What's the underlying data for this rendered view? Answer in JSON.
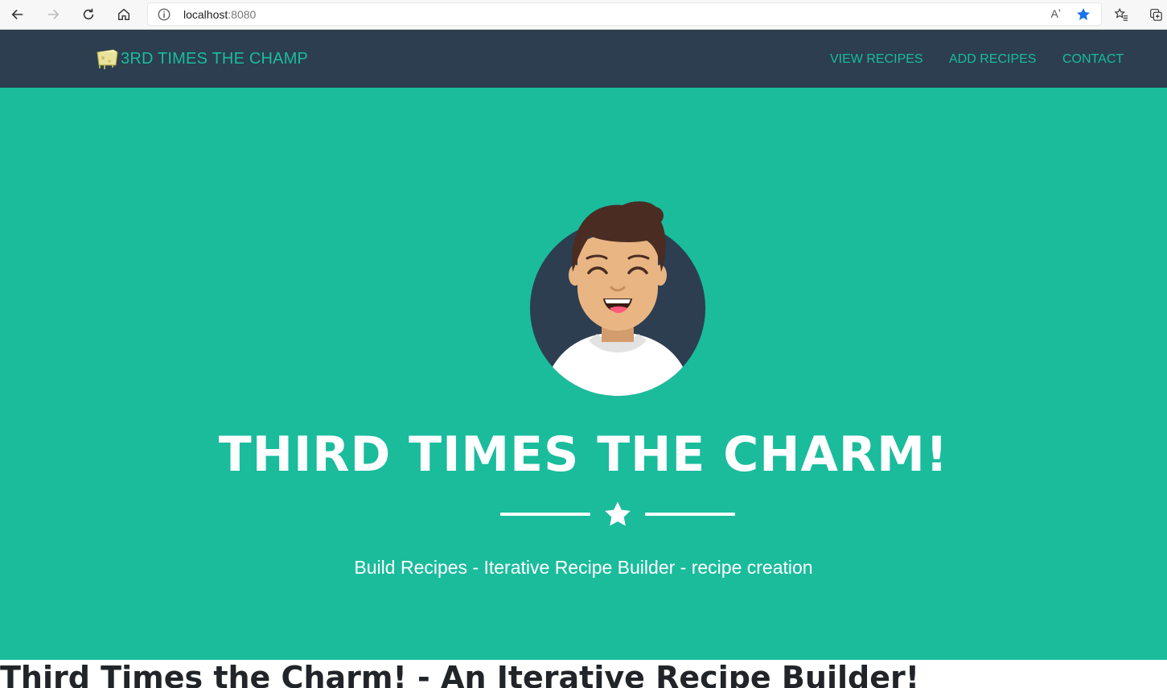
{
  "browser": {
    "url_host": "localhost",
    "url_port": ":8080",
    "read_aloud": "Aʼ",
    "colors": {
      "favorite_star": "#1a73e8"
    }
  },
  "navbar": {
    "brand": "3RD TIMES THE CHAMP",
    "links": [
      {
        "label": "VIEW RECIPES"
      },
      {
        "label": "ADD RECIPES"
      },
      {
        "label": "CONTACT"
      }
    ],
    "colors": {
      "background": "#2c3e50",
      "accent": "#1abc9c"
    }
  },
  "hero": {
    "title": "THIRD TIMES THE CHARM!",
    "subtitle": "Build Recipes - Iterative Recipe Builder - recipe creation",
    "colors": {
      "background": "#1abc9c",
      "text": "#ffffff"
    },
    "icons": {
      "avatar": "avatar-icon",
      "divider": "star-icon"
    }
  },
  "section": {
    "title": "Third Times the Charm! - An Iterative Recipe Builder!"
  }
}
